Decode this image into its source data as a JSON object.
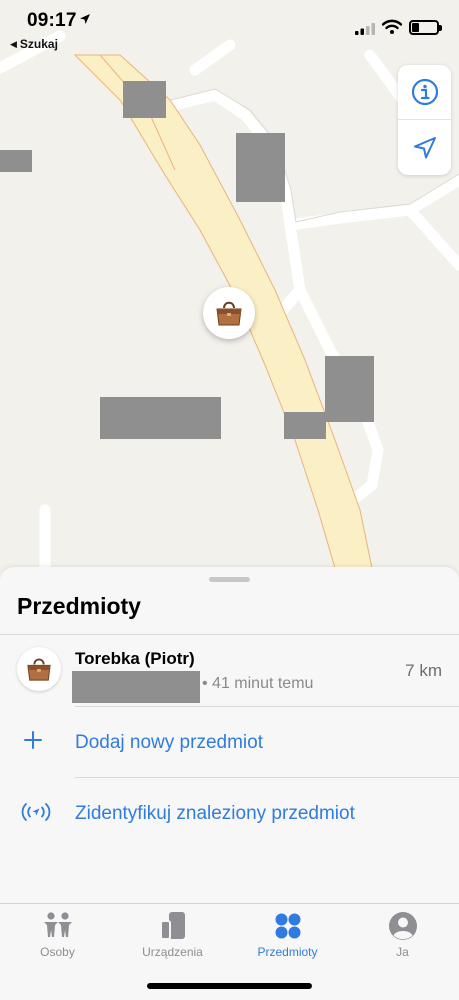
{
  "status_bar": {
    "time": "09:17",
    "back_label": "Szukaj",
    "icons": [
      "location-arrow-icon",
      "signal-icon",
      "wifi-icon",
      "battery-icon"
    ]
  },
  "map": {
    "controls": [
      "info-icon",
      "location-arrow-icon"
    ],
    "pin_icon": "handbag-icon"
  },
  "sheet": {
    "title": "Przedmioty",
    "items": [
      {
        "name": "Torebka (Piotr)",
        "time": "• 41 minut temu",
        "distance": "7 km",
        "icon": "handbag-icon"
      }
    ],
    "actions": [
      {
        "label": "Dodaj nowy przedmiot",
        "icon": "plus-icon"
      },
      {
        "label": "Zidentyfikuj znaleziony przedmiot",
        "icon": "airtag-signal-icon"
      }
    ]
  },
  "tabbar": {
    "tabs": [
      {
        "label": "Osoby",
        "icon": "people-icon"
      },
      {
        "label": "Urządzenia",
        "icon": "devices-icon"
      },
      {
        "label": "Przedmioty",
        "icon": "items-icon",
        "active": true
      },
      {
        "label": "Ja",
        "icon": "person-icon"
      }
    ]
  },
  "colors": {
    "accent": "#2f7be0",
    "road_main": "#fbf0c5",
    "road_edge": "#e9b47a",
    "map_bg": "#f3f1ec",
    "redaction": "#8f8f8f"
  }
}
